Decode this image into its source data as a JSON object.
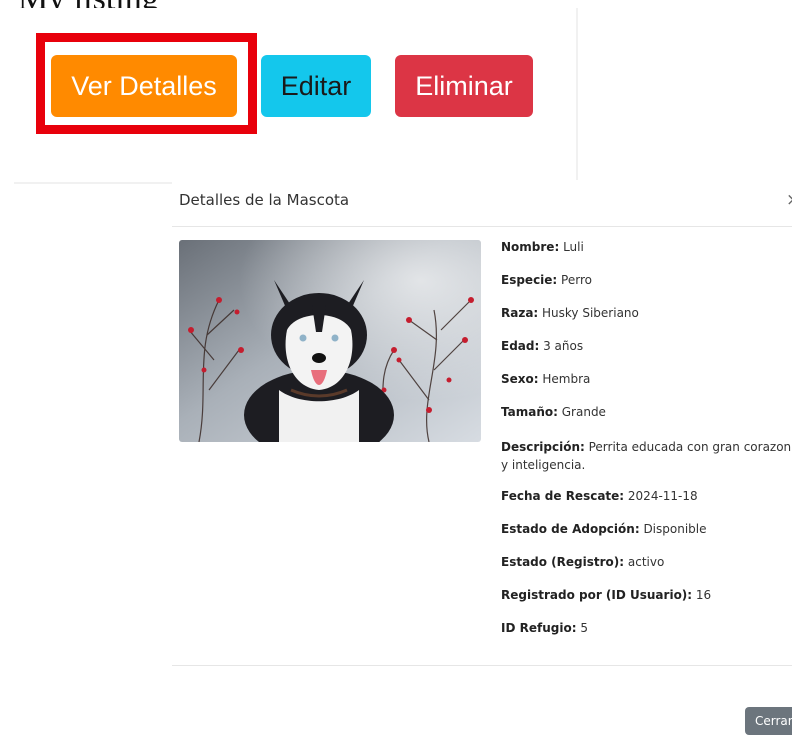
{
  "top_text": "My listing",
  "actions": {
    "details_label": "Ver Detalles",
    "edit_label": "Editar",
    "delete_label": "Eliminar"
  },
  "colors": {
    "highlight": "#e8000b",
    "details_button": "#ff8a00",
    "edit_button": "#14c7ec",
    "delete_button": "#dc3545",
    "close_button": "#6c757d"
  },
  "modal": {
    "title": "Detalles de la Mascota",
    "close_icon": "close-icon",
    "photo_alt": "husky-dog-photo",
    "fields": [
      {
        "label": "Nombre:",
        "value": " Luli"
      },
      {
        "label": "Especie:",
        "value": " Perro"
      },
      {
        "label": "Raza:",
        "value": " Husky Siberiano"
      },
      {
        "label": "Edad:",
        "value": " 3 años"
      },
      {
        "label": "Sexo:",
        "value": " Hembra"
      },
      {
        "label": "Tamaño:",
        "value": " Grande"
      },
      {
        "label": "Descripción:",
        "value": " Perrita educada con gran corazon y inteligencia."
      },
      {
        "label": "Fecha de Rescate:",
        "value": " 2024-11-18"
      },
      {
        "label": "Estado de Adopción:",
        "value": " Disponible"
      },
      {
        "label": "Estado (Registro):",
        "value": " activo"
      },
      {
        "label": "Registrado por (ID Usuario):",
        "value": " 16"
      },
      {
        "label": "ID Refugio:",
        "value": " 5"
      }
    ],
    "close_button_label": "Cerrar"
  }
}
